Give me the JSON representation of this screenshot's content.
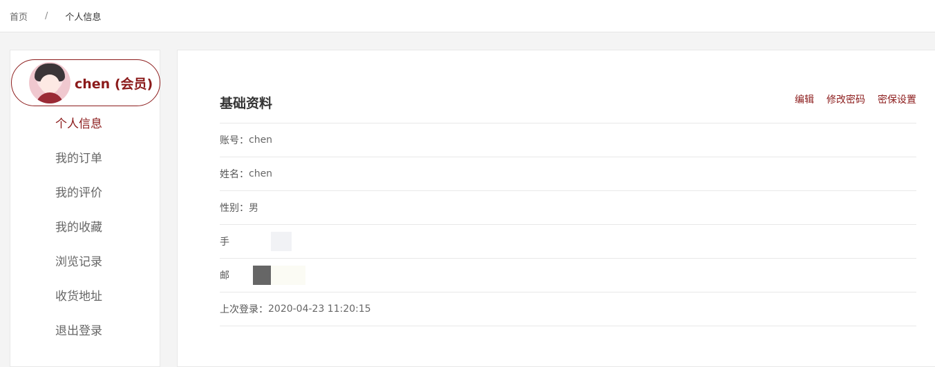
{
  "breadcrumb": {
    "home": "首页",
    "separator": "/",
    "current": "个人信息"
  },
  "user": {
    "name": "chen (会员)"
  },
  "nav": {
    "items": [
      {
        "label": "个人信息",
        "active": true
      },
      {
        "label": "我的订单"
      },
      {
        "label": "我的评价"
      },
      {
        "label": "我的收藏"
      },
      {
        "label": "浏览记录"
      },
      {
        "label": "收货地址"
      },
      {
        "label": "退出登录"
      }
    ]
  },
  "section": {
    "title": "基础资料",
    "actions": {
      "edit": "编辑",
      "change_password": "修改密码",
      "security_settings": "密保设置"
    }
  },
  "info": {
    "account_label": "账号：",
    "account_value": "chen",
    "name_label": "姓名：",
    "name_value": "chen",
    "gender_label": "性别：",
    "gender_value": "男",
    "phone_label": "手",
    "email_label": "邮",
    "last_login_label": "上次登录：",
    "last_login_value": "2020-04-23 11:20:15"
  },
  "colors": {
    "accent": "#8b1a1a",
    "background": "#f4f4f4",
    "border": "#e8e8e8"
  }
}
